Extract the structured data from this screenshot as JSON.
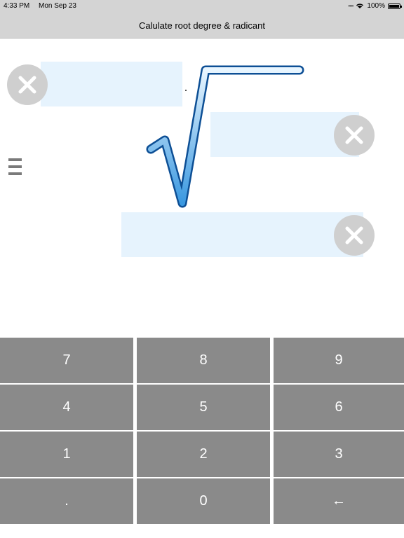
{
  "status": {
    "time": "4:33 PM",
    "date": "Mon Sep 23",
    "battery": "100%",
    "battery_level": 1.0
  },
  "nav": {
    "title": "Calulate root degree & radicant"
  },
  "fields": {
    "degree_value": "",
    "radicand_value": "",
    "result_value": ""
  },
  "icons": {
    "clear": "close-circle-icon",
    "root": "square-root-icon",
    "equals": "equals-icon",
    "wifi": "wifi-icon",
    "battery": "battery-icon",
    "signal": "signal-dots-icon"
  },
  "colors": {
    "bar_bg": "#d4d4d4",
    "field_bg": "#e6f3fd",
    "key_bg": "#8a8a8a",
    "key_text": "#ffffff",
    "clear_bg": "#cfcfcf",
    "root_blue": "#3a98e0"
  },
  "keypad": {
    "rows": [
      [
        "7",
        "8",
        "9"
      ],
      [
        "4",
        "5",
        "6"
      ],
      [
        "1",
        "2",
        "3"
      ],
      [
        ".",
        "0",
        "←"
      ]
    ]
  }
}
